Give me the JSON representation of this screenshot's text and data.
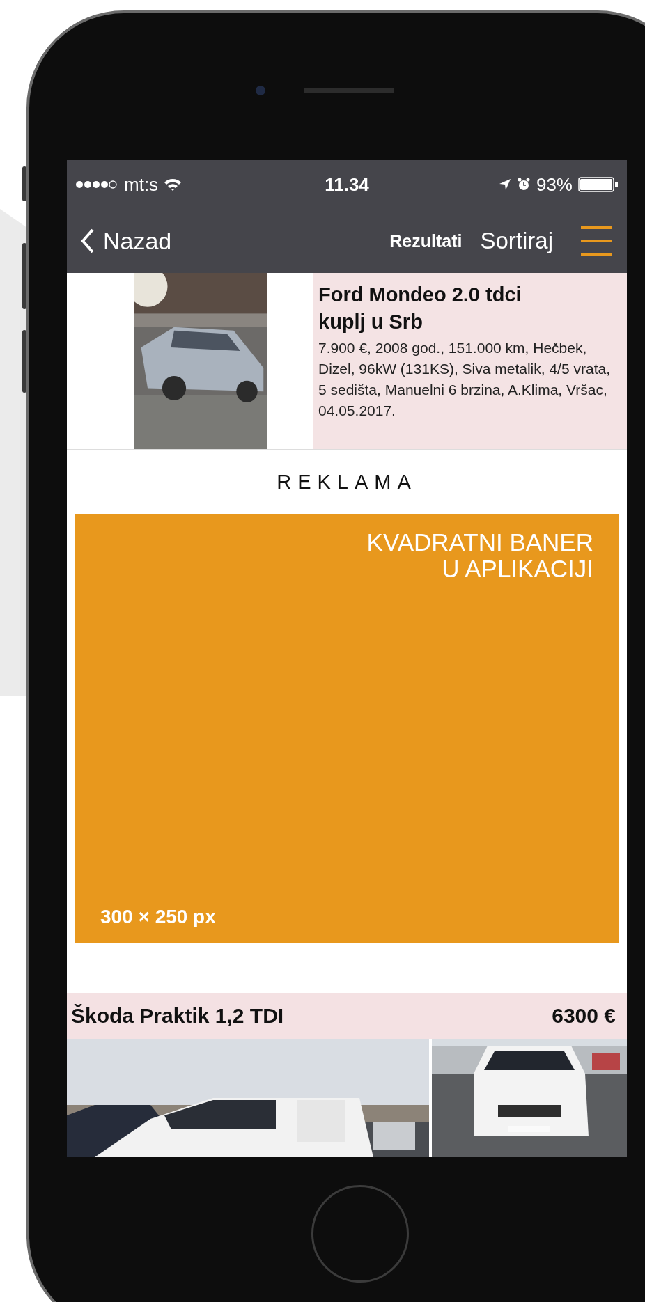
{
  "status_bar": {
    "carrier": "mt:s",
    "time": "11.34",
    "battery": "93%"
  },
  "nav_bar": {
    "back": "Nazad",
    "title": "Rezultati",
    "sort": "Sortiraj"
  },
  "listings": [
    {
      "kind": "detail",
      "title": "Ford Mondeo 2.0 tdci kuplj u Srb",
      "description": "7.900 €, 2008 god., 151.000 km, Hečbek, Dizel, 96kW (131KS), Siva metalik, 4/5 vrata, 5 sedišta, Manuelni 6 brzina, A.Klima, Vršac, 04.05.2017."
    },
    {
      "kind": "ad",
      "label": "REKLAMA",
      "banner_lines": [
        "KVADRATNI BANER",
        "U APLIKACIJI"
      ],
      "banner_size": "300 × 250 px"
    },
    {
      "kind": "gallery",
      "title": "Škoda Praktik 1,2 TDI",
      "price": "6300 €"
    }
  ]
}
